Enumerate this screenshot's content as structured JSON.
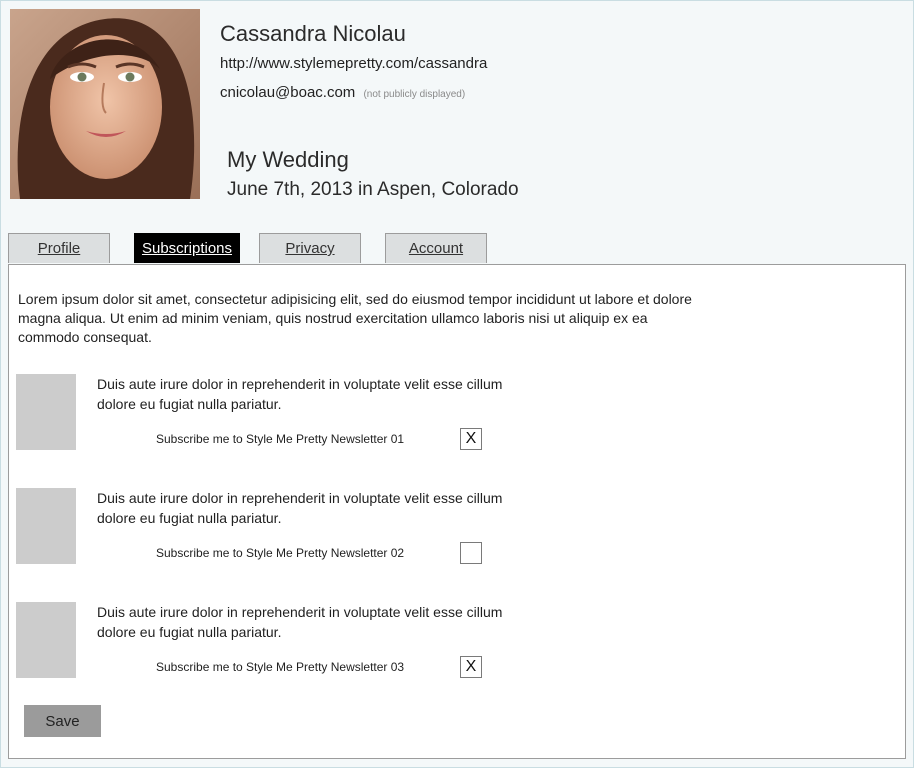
{
  "profile": {
    "name": "Cassandra Nicolau",
    "url": "http://www.stylemepretty.com/cassandra",
    "email": "cnicolau@boac.com",
    "email_note": "(not publicly displayed)",
    "photo_icon": "profile-photo"
  },
  "wedding": {
    "title": "My Wedding",
    "date_location": "June 7th, 2013 in Aspen, Colorado"
  },
  "tabs": [
    {
      "label": "Profile",
      "active": false
    },
    {
      "label": "Subscriptions",
      "active": true
    },
    {
      "label": "Privacy",
      "active": false
    },
    {
      "label": "Account",
      "active": false
    }
  ],
  "panel": {
    "intro": "Lorem ipsum dolor sit amet, consectetur adipisicing elit, sed do eiusmod tempor incididunt ut labore et dolore magna aliqua. Ut enim ad minim veniam, quis nostrud exercitation ullamco laboris nisi ut aliquip ex ea commodo consequat.",
    "subscriptions": [
      {
        "description": "Duis aute irure dolor in reprehenderit in voluptate velit esse cillum dolore eu fugiat nulla pariatur.",
        "label": "Subscribe me to Style Me Pretty Newsletter 01",
        "checked": true,
        "check_mark": "X"
      },
      {
        "description": "Duis aute irure dolor in reprehenderit in voluptate velit esse cillum dolore eu fugiat nulla pariatur.",
        "label": "Subscribe me to Style Me Pretty Newsletter 02",
        "checked": false,
        "check_mark": ""
      },
      {
        "description": "Duis aute irure dolor in reprehenderit in voluptate velit esse cillum dolore eu fugiat nulla pariatur.",
        "label": "Subscribe me to Style Me Pretty Newsletter 03",
        "checked": true,
        "check_mark": "X"
      }
    ],
    "save_label": "Save"
  },
  "colors": {
    "active_tab_bg": "#000000",
    "inactive_tab_bg": "#dcdfe0",
    "save_button_bg": "#9b9b9b",
    "placeholder_thumb": "#cccccc"
  }
}
